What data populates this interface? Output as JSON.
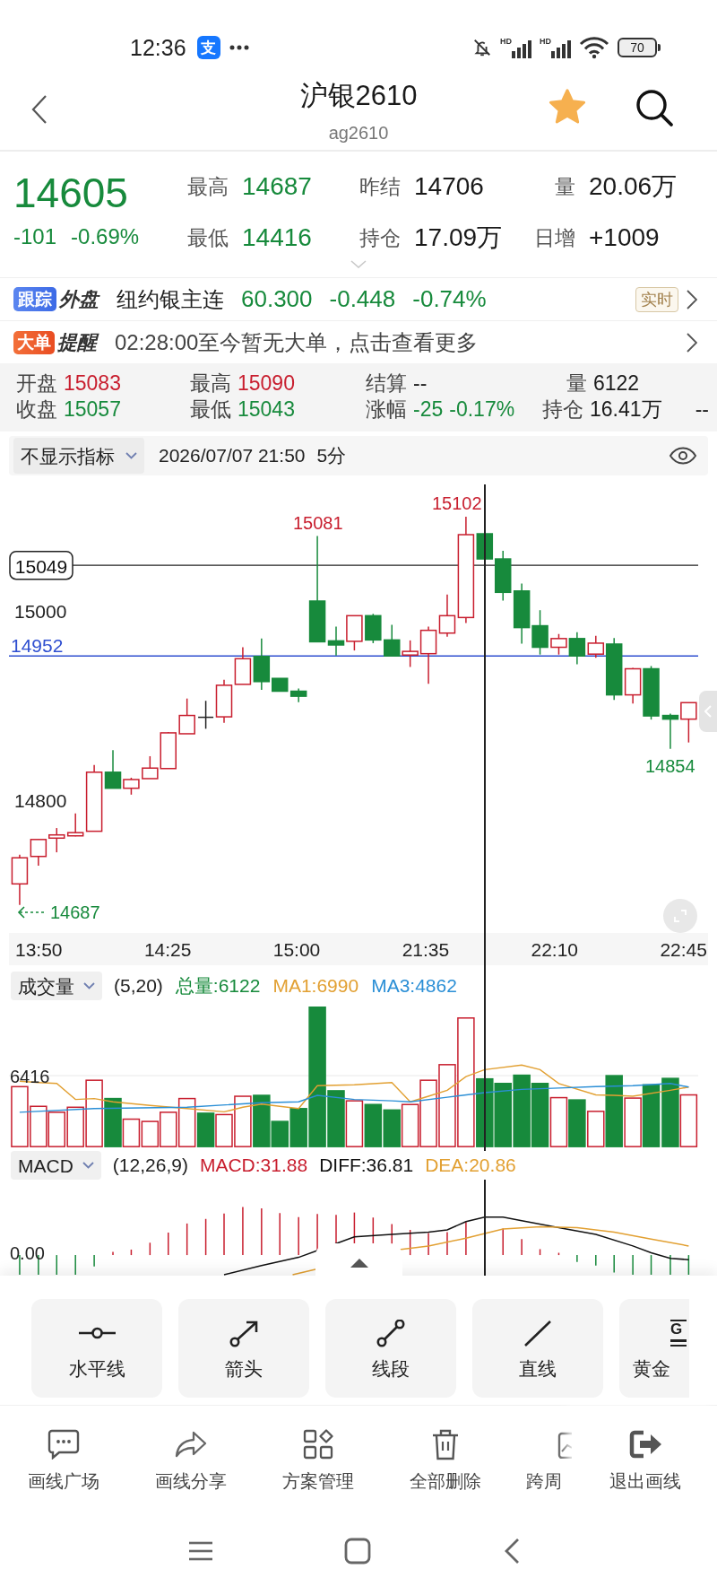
{
  "status_bar": {
    "time": "12:36",
    "app_badge": "支",
    "signals": [
      {
        "label": "HD"
      },
      {
        "label": "HD"
      }
    ],
    "battery": "70"
  },
  "header": {
    "title": "沪银2610",
    "subtitle": "ag2610",
    "favorited": true
  },
  "quote": {
    "price": "14605",
    "change": "-101",
    "change_percent": "-0.69%",
    "color": "#178a3c",
    "stats": [
      {
        "label": "最高",
        "value": "14687",
        "color": "#178a3c"
      },
      {
        "label": "昨结",
        "value": "14706",
        "color": "#1a1a1a"
      },
      {
        "label": "量",
        "value": "20.06万",
        "color": "#1a1a1a"
      },
      {
        "label": "最低",
        "value": "14416",
        "color": "#178a3c"
      },
      {
        "label": "持仓",
        "value": "17.09万",
        "color": "#1a1a1a"
      },
      {
        "label": "日增",
        "value": "+1009",
        "color": "#1a1a1a"
      }
    ]
  },
  "tracking": {
    "badge": "跟踪",
    "badge_suffix": "外盘",
    "name": "纽约银主连",
    "price": "60.300",
    "change": "-0.448",
    "change_percent": "-0.74%",
    "color": "#178a3c",
    "tag": "实时"
  },
  "big_order": {
    "badge": "大单",
    "badge_suffix": "提醒",
    "message": "02:28:00至今暂无大单，点击查看更多"
  },
  "ohlc": {
    "rows": [
      {
        "cells": [
          {
            "label": "开盘",
            "values": [
              "15083"
            ],
            "color": "#c81e2e"
          },
          {
            "label": "最高",
            "values": [
              "15090"
            ],
            "color": "#c81e2e"
          },
          {
            "label": "结算",
            "values": [
              "--"
            ],
            "color": "#1a1a1a"
          },
          {
            "label": "量",
            "values": [
              "6122"
            ],
            "color": "#1a1a1a"
          }
        ]
      },
      {
        "cells": [
          {
            "label": "收盘",
            "values": [
              "15057"
            ],
            "color": "#178a3c"
          },
          {
            "label": "最低",
            "values": [
              "15043"
            ],
            "color": "#178a3c"
          },
          {
            "label": "涨幅",
            "values": [
              "-25",
              "-0.17%"
            ],
            "color": "#178a3c"
          },
          {
            "label": "持仓",
            "values": [
              "16.41万"
            ],
            "color": "#1a1a1a"
          }
        ],
        "trailing": "--"
      }
    ]
  },
  "indicator_bar": {
    "indicator": "不显示指标",
    "datetime": "2026/07/07 21:50",
    "period": "5分"
  },
  "kline": {
    "price_lines": [
      {
        "label": "15049",
        "kind": "marker"
      },
      {
        "label": "14952",
        "kind": "reference"
      }
    ],
    "y_labels": [
      "15000",
      "14800"
    ],
    "extremes": [
      {
        "label": "15081",
        "kind": "high"
      },
      {
        "label": "15102",
        "kind": "high"
      },
      {
        "label": "14854",
        "kind": "low"
      },
      {
        "label": "14687",
        "kind": "arrow"
      }
    ],
    "time_labels": [
      "13:50",
      "14:25",
      "15:00",
      "21:35",
      "22:10",
      "22:45"
    ]
  },
  "volume": {
    "selector": "成交量",
    "params": "(5,20)",
    "legend": [
      {
        "text": "总量:6122",
        "color": "#178a3c"
      },
      {
        "text": "MA1:6990",
        "color": "#e2a032"
      },
      {
        "text": "MA3:4862",
        "color": "#2b8fd6"
      }
    ],
    "y_label": "6416"
  },
  "macd": {
    "selector": "MACD",
    "params": "(12,26,9)",
    "legend": [
      {
        "text": "MACD:31.88",
        "color": "#c81e2e"
      },
      {
        "text": "DIFF:36.81",
        "color": "#111111"
      },
      {
        "text": "DEA:20.86",
        "color": "#e2a032"
      }
    ],
    "y_label": "0.00"
  },
  "drawing_tools": [
    {
      "label": "水平线",
      "kind": "full"
    },
    {
      "label": "箭头",
      "kind": "full"
    },
    {
      "label": "线段",
      "kind": "full"
    },
    {
      "label": "直线",
      "kind": "full"
    },
    {
      "label": "黄金",
      "kind": "cut",
      "icon_text": "G"
    }
  ],
  "actions": [
    {
      "label": "画线广场",
      "kind": "full"
    },
    {
      "label": "画线分享",
      "kind": "full"
    },
    {
      "label": "方案管理",
      "kind": "full"
    },
    {
      "label": "全部删除",
      "kind": "full"
    },
    {
      "label": "跨周",
      "kind": "cut"
    }
  ],
  "exit_action": {
    "label": "退出画线"
  }
}
